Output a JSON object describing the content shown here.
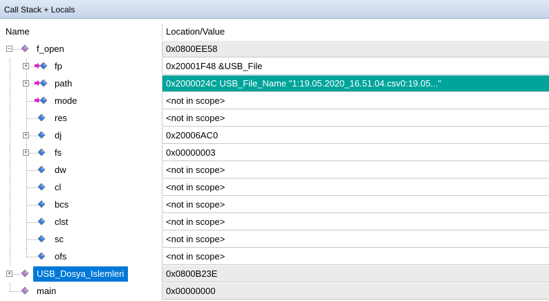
{
  "window": {
    "title": "Call Stack + Locals"
  },
  "columns": {
    "name": "Name",
    "value": "Location/Value"
  },
  "rows": [
    {
      "name": "f_open",
      "value": "0x0800EE58",
      "level": 0,
      "expander": "minus",
      "icon": "function-icon",
      "shaded": true
    },
    {
      "name": "fp",
      "value": "0x20001F48 &USB_File",
      "level": 1,
      "expander": "plus",
      "icon": "pointer-param-icon"
    },
    {
      "name": "path",
      "value": "0x2000024C USB_File_Name \"1:19.05.2020_16.51.04.csv0:19.05...\"",
      "level": 1,
      "expander": "plus",
      "icon": "pointer-param-icon",
      "highlight": true
    },
    {
      "name": "mode",
      "value": "<not in scope>",
      "level": 1,
      "icon": "pointer-param-icon"
    },
    {
      "name": "res",
      "value": "<not in scope>",
      "level": 1,
      "icon": "variable-icon"
    },
    {
      "name": "dj",
      "value": "0x20006AC0",
      "level": 1,
      "expander": "plus",
      "icon": "variable-icon"
    },
    {
      "name": "fs",
      "value": "0x00000003",
      "level": 1,
      "expander": "plus",
      "icon": "variable-icon"
    },
    {
      "name": "dw",
      "value": "<not in scope>",
      "level": 1,
      "icon": "variable-icon"
    },
    {
      "name": "cl",
      "value": "<not in scope>",
      "level": 1,
      "icon": "variable-icon"
    },
    {
      "name": "bcs",
      "value": "<not in scope>",
      "level": 1,
      "icon": "variable-icon"
    },
    {
      "name": "clst",
      "value": "<not in scope>",
      "level": 1,
      "icon": "variable-icon"
    },
    {
      "name": "sc",
      "value": "<not in scope>",
      "level": 1,
      "icon": "variable-icon"
    },
    {
      "name": "ofs",
      "value": "<not in scope>",
      "level": 1,
      "icon": "variable-icon"
    },
    {
      "name": "USB_Dosya_Islemleri",
      "value": "0x0800B23E",
      "level": 0,
      "expander": "plus",
      "icon": "function-icon",
      "shaded": true,
      "selected": true
    },
    {
      "name": "main",
      "value": "0x00000000",
      "level": 0,
      "icon": "function-icon",
      "shaded": true
    }
  ],
  "colors": {
    "highlight": "#00a49a",
    "selection": "#0078d7",
    "function_icon": "#b07fd0",
    "pointer_arrow": "#e020c0",
    "variable_icon": "#3a7fe0"
  }
}
